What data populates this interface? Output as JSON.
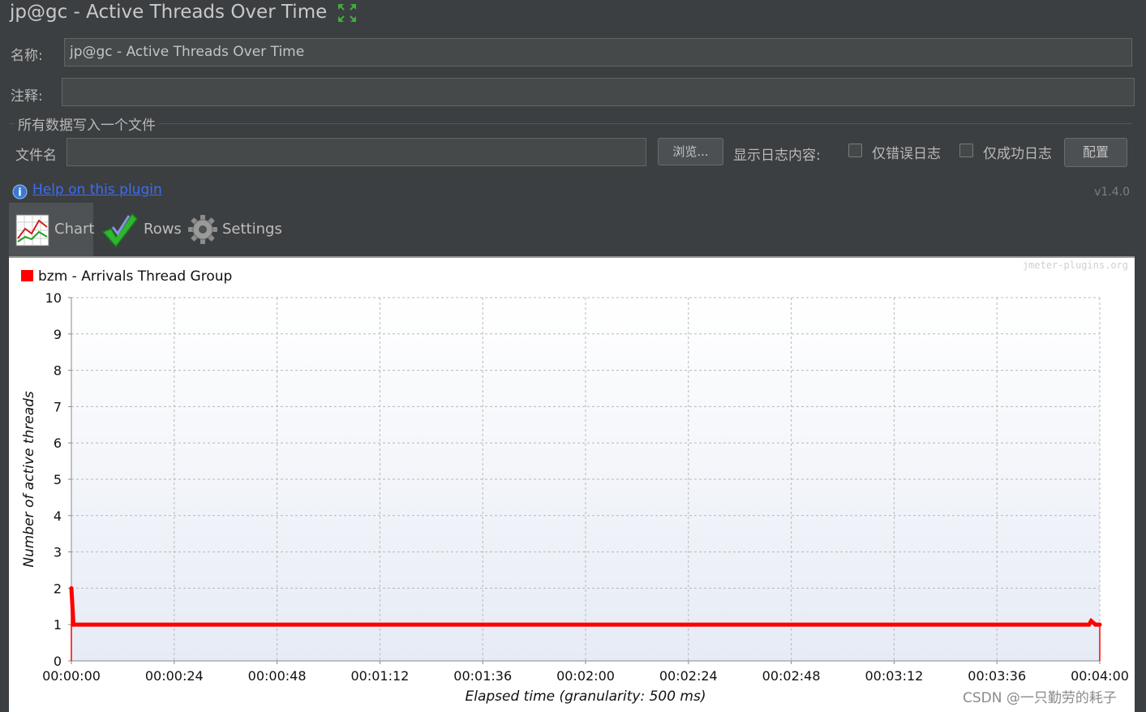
{
  "window": {
    "title": "jp@gc - Active Threads Over Time"
  },
  "form": {
    "name_label": "名称:",
    "name_value": "jp@gc - Active Threads Over Time",
    "comment_label": "注释:",
    "comment_value": "",
    "section_title": "所有数据写入一个文件",
    "file_label": "文件名",
    "file_value": "",
    "browse_button": "浏览...",
    "log_label": "显示日志内容:",
    "errors_only": "仅错误日志",
    "success_only": "仅成功日志",
    "configure_button": "配置"
  },
  "help": {
    "link_text": "Help on this plugin",
    "version": "v1.4.0"
  },
  "tabs": [
    {
      "label": "Chart",
      "icon": "chart-icon",
      "active": true
    },
    {
      "label": "Rows",
      "icon": "checkmark-icon",
      "active": false
    },
    {
      "label": "Settings",
      "icon": "gear-icon",
      "active": false
    }
  ],
  "watermarks": {
    "plugins": "jmeter-plugins.org",
    "csdn": "CSDN @一只勤劳的耗子"
  },
  "chart_data": {
    "type": "line",
    "legend": [
      {
        "name": "bzm - Arrivals Thread Group",
        "color": "#ff0000"
      }
    ],
    "xlabel": "Elapsed time (granularity: 500 ms)",
    "ylabel": "Number of active threads",
    "ylim": [
      0,
      10
    ],
    "yticks": [
      "0",
      "1",
      "2",
      "3",
      "4",
      "5",
      "6",
      "7",
      "8",
      "9",
      "10"
    ],
    "xlim_seconds": [
      0,
      240
    ],
    "xticks": [
      "00:00:00",
      "00:00:24",
      "00:00:48",
      "00:01:12",
      "00:01:36",
      "00:02:00",
      "00:02:24",
      "00:02:48",
      "00:03:12",
      "00:03:36",
      "00:04:00"
    ],
    "grid": true,
    "series": [
      {
        "name": "bzm - Arrivals Thread Group",
        "color": "#ff0000",
        "x_seconds": [
          0,
          0,
          0.5,
          120,
          237.5,
          238,
          239,
          239.5,
          240,
          240
        ],
        "y": [
          0,
          2,
          1,
          1,
          1,
          1.1,
          1,
          1,
          1,
          0
        ]
      }
    ]
  }
}
